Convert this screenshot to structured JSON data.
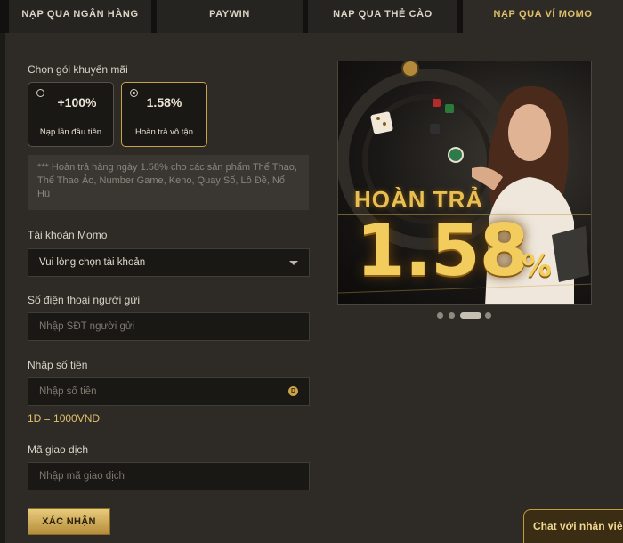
{
  "tabs": [
    {
      "label": "NẠP QUA NGÂN HÀNG"
    },
    {
      "label": "PAYWIN"
    },
    {
      "label": "NẠP QUA THẺ CÀO"
    },
    {
      "label": "NẠP QUA VÍ MOMO",
      "active": true
    }
  ],
  "promo": {
    "label": "Chọn gói khuyến mãi",
    "options": [
      {
        "value": "+100%",
        "caption": "Nạp lần đầu tiên",
        "selected": false
      },
      {
        "value": "1.58%",
        "caption": "Hoàn trả vô tận",
        "selected": true
      }
    ],
    "note": "*** Hoàn trả hàng ngày 1.58% cho các sản phẩm Thể Thao, Thể Thao Ảo, Number Game, Keno, Quay Số, Lô Đề, Nổ Hũ"
  },
  "momo_account": {
    "label": "Tài khoản Momo",
    "selected": "Vui lòng chọn tài khoản"
  },
  "sender_phone": {
    "label": "Số điện thoại người gửi",
    "placeholder": "Nhập SĐT người gửi"
  },
  "amount": {
    "label": "Nhập số tiền",
    "placeholder": "Nhập số tiền",
    "coin_symbol": "D",
    "rate": "1D = 1000VND"
  },
  "transaction_code": {
    "label": "Mã giao dịch",
    "placeholder": "Nhập mã giao dịch"
  },
  "submit_label": "XÁC NHẬN",
  "banner": {
    "title": "HOÀN TRẢ",
    "number": "1.58",
    "percent": "%",
    "active_slide": 3,
    "slide_count": 4
  },
  "chat_label": "Chat với nhân viên",
  "colors": {
    "accent": "#e2c06a",
    "background": "#2e2b26",
    "input_bg": "#1a1815"
  }
}
